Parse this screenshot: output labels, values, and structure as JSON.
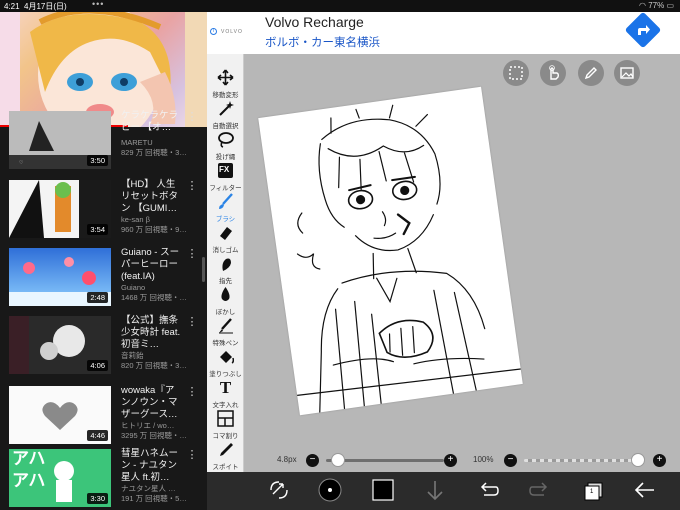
{
  "status": {
    "time": "4:21",
    "date": "4月17日(日)",
    "battery": "77%"
  },
  "youtube": {
    "now_playing_progress": 0.62,
    "videos": [
      {
        "title": "ケラケラケラ ビー 【オ…",
        "channel": "MARETU",
        "meta": "829 万 回視聴・3…",
        "duration": "3:50"
      },
      {
        "title": "【HD】 人生リセットボタン 【GUMI…",
        "channel": "ke-san β",
        "meta": "960 万 回視聴・9…",
        "duration": "3:54"
      },
      {
        "title": "Guiano - スーパーヒーロー (feat.IA)",
        "channel": "Guiano",
        "meta": "1468 万 回視聴・…",
        "duration": "2:48"
      },
      {
        "title": "【公式】撫条少女時計 feat.初音ミ…",
        "channel": "音莉飴",
        "meta": "820 万 回視聴・3…",
        "duration": "4:06"
      },
      {
        "title": "wowaka『アンノウン・マザーグース…",
        "channel": "ヒトリエ / wo…",
        "meta": "3295 万 回視聴・…",
        "duration": "4:46"
      },
      {
        "title": "彗星ハネムーン - ナユタン星人 ft.初…",
        "channel": "ナユタン星人 …",
        "meta": "191 万 回視聴・5…",
        "duration": "3:30"
      }
    ],
    "thumb5_text": "アハ"
  },
  "ad": {
    "brand": "VOLVO",
    "title": "Volvo Recharge",
    "subtitle": "ボルボ・カー東名横浜",
    "info": "i"
  },
  "toolbar": {
    "tools": [
      {
        "label": "移動変形",
        "icon": "move-icon"
      },
      {
        "label": "自動選択",
        "icon": "magic-wand-icon"
      },
      {
        "label": "投げ縄",
        "icon": "lasso-icon"
      },
      {
        "label": "フィルター",
        "icon": "filter-icon",
        "fx": "FX"
      },
      {
        "label": "ブラシ",
        "icon": "brush-icon",
        "active": true
      },
      {
        "label": "消しゴム",
        "icon": "eraser-icon"
      },
      {
        "label": "指先",
        "icon": "finger-icon"
      },
      {
        "label": "ぼかし",
        "icon": "blur-icon"
      },
      {
        "label": "特殊ペン",
        "icon": "special-pen-icon"
      },
      {
        "label": "塗りつぶし",
        "icon": "fill-icon"
      },
      {
        "label": "文字入れ",
        "icon": "text-icon",
        "glyph": "T"
      },
      {
        "label": "コマ割り",
        "icon": "frame-icon"
      },
      {
        "label": "スポイト",
        "icon": "eyedropper-icon"
      },
      {
        "label": "キャンバス",
        "icon": "canvas-icon"
      }
    ]
  },
  "sliders": {
    "brush_size_label": "4.8px",
    "brush_size_value": 0.05,
    "opacity_label": "100%",
    "opacity_value": 1.0,
    "minus": "−",
    "plus": "+"
  },
  "bottom_bar": {
    "layer_count": "1"
  },
  "colors": {
    "accent": "#2b84e6",
    "ad_link": "#1a56c7",
    "dark_bar": "#2b2b2b"
  }
}
